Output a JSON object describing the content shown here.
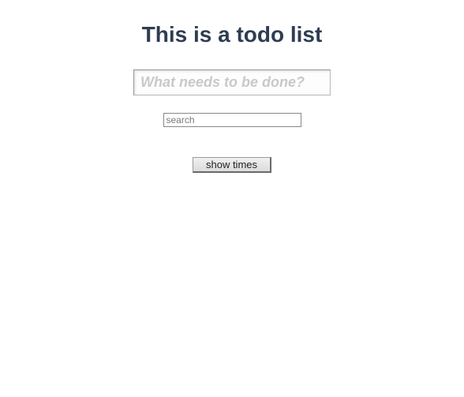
{
  "header": {
    "title": "This is a todo list"
  },
  "inputs": {
    "new_todo_placeholder": "What needs to be done?",
    "search_placeholder": "search"
  },
  "buttons": {
    "show_times_label": "show times"
  }
}
